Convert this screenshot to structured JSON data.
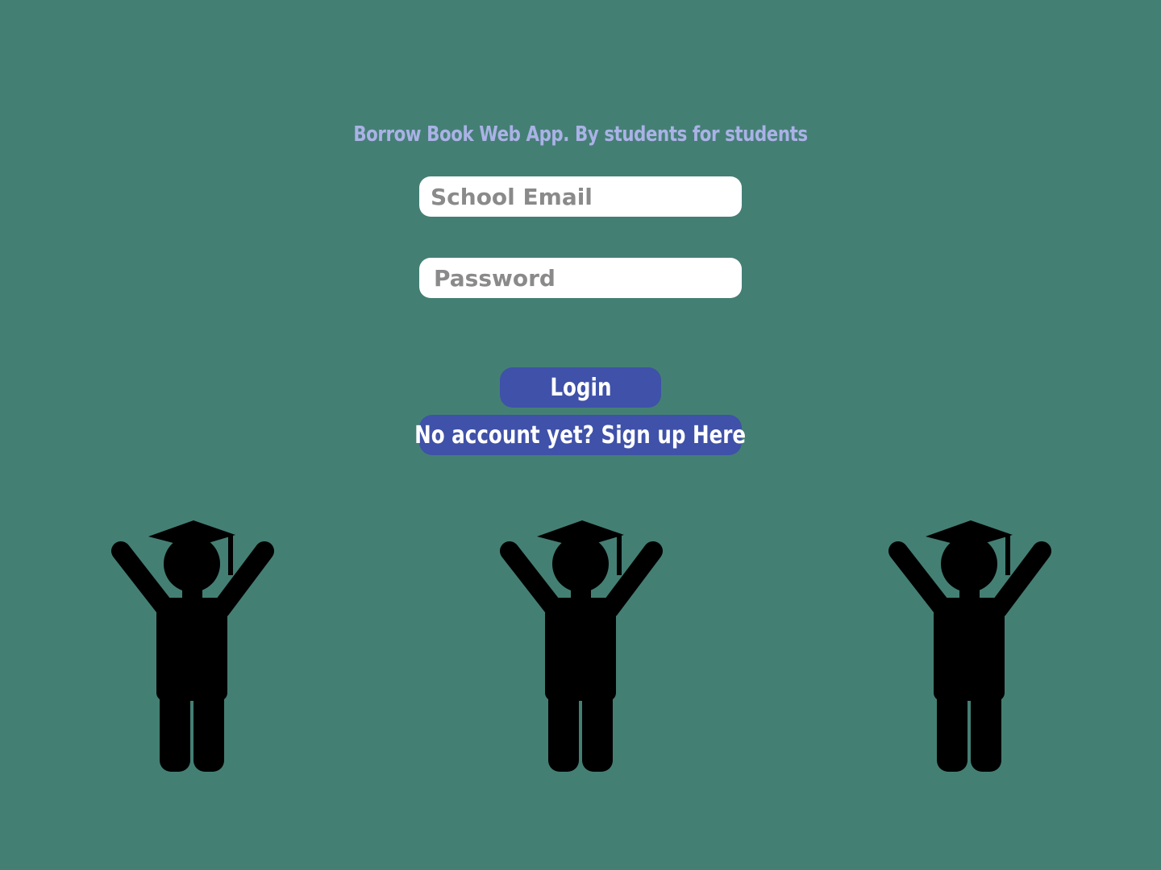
{
  "header": {
    "tagline": "Borrow Book Web App. By students for students"
  },
  "form": {
    "email_placeholder": "School Email",
    "password_placeholder": "Password",
    "login_label": "Login",
    "signup_label": "No account yet? Sign up Here"
  },
  "illustration": {
    "figures": [
      "graduate-student-icon",
      "graduate-student-icon",
      "graduate-student-icon"
    ]
  },
  "colors": {
    "background": "#447f74",
    "tagline": "#aab2e6",
    "button": "#3f51a8",
    "button_text": "#ffffff",
    "field_bg": "#ffffff",
    "placeholder": "#8a8a8a",
    "figure": "#000000"
  }
}
